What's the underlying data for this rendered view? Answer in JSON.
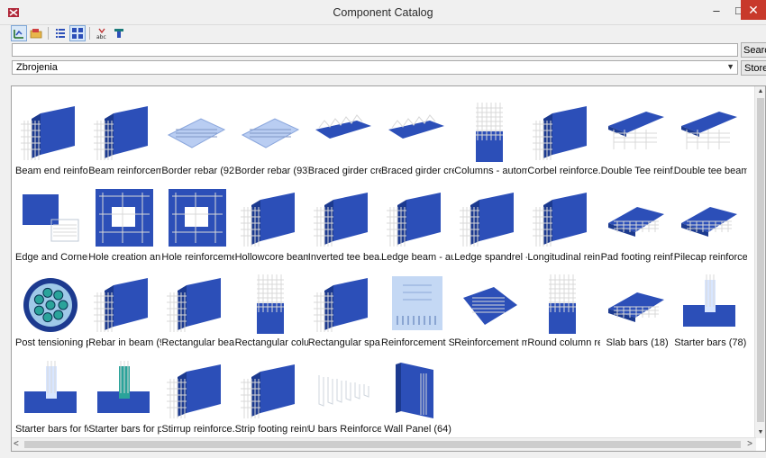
{
  "window": {
    "title": "Component Catalog"
  },
  "window_controls": {
    "minimize": "–",
    "maximize": "□",
    "close": "✕"
  },
  "toolbar": {
    "buttons": [
      "group-view-icon",
      "folder-icon",
      "list-view-icon",
      "thumbnail-view-icon",
      "abc-sort-icon",
      "filter-icon"
    ]
  },
  "search": {
    "value": "",
    "button_label": "Search"
  },
  "catalog_selector": {
    "value": "Zbrojenia",
    "store_label": "Store"
  },
  "colors": {
    "blue": "#2c4fb8",
    "dark_blue": "#1c3a8f",
    "teal": "#2aa39a",
    "rebar": "#d8d8d8",
    "close_red": "#c8392b"
  },
  "items": [
    {
      "label": "Beam end reinfor...",
      "icon": "beam-end-reinforcement-icon"
    },
    {
      "label": "Beam reinforcem...",
      "icon": "beam-reinforcement-icon"
    },
    {
      "label": "Border rebar (92)",
      "icon": "border-rebar-icon"
    },
    {
      "label": "Border rebar (93)",
      "icon": "border-rebar-icon"
    },
    {
      "label": "Braced girder cre...",
      "icon": "braced-girder-icon"
    },
    {
      "label": "Braced girder cre...",
      "icon": "braced-girder-icon"
    },
    {
      "label": "Columns - autom...",
      "icon": "columns-icon"
    },
    {
      "label": "Corbel reinforce...",
      "icon": "corbel-reinforcement-icon"
    },
    {
      "label": "Double Tee reinf...",
      "icon": "double-tee-icon"
    },
    {
      "label": "Double tee beam...",
      "icon": "double-tee-beam-icon"
    },
    {
      "label": "Edge and Corner...",
      "icon": "edge-corner-icon"
    },
    {
      "label": "Hole creation an...",
      "icon": "hole-creation-icon"
    },
    {
      "label": "Hole reinforceme...",
      "icon": "hole-reinforcement-icon"
    },
    {
      "label": "Hollowcore beam...",
      "icon": "hollowcore-beam-icon"
    },
    {
      "label": "Inverted tee bea...",
      "icon": "inverted-tee-beam-icon"
    },
    {
      "label": "Ledge beam - au...",
      "icon": "ledge-beam-icon"
    },
    {
      "label": "Ledge spandrel - ...",
      "icon": "ledge-spandrel-icon"
    },
    {
      "label": "Longitudinal reinf...",
      "icon": "longitudinal-reinforcement-icon"
    },
    {
      "label": "Pad footing reinf...",
      "icon": "pad-footing-icon"
    },
    {
      "label": "Pilecap reinforce...",
      "icon": "pilecap-reinforcement-icon"
    },
    {
      "label": "Post tensioning p...",
      "icon": "post-tensioning-icon"
    },
    {
      "label": "Rebar in beam (90)",
      "icon": "rebar-in-beam-icon"
    },
    {
      "label": "Rectangular bea...",
      "icon": "rectangular-beam-icon"
    },
    {
      "label": "Rectangular colu...",
      "icon": "rectangular-column-icon"
    },
    {
      "label": "Rectangular spa...",
      "icon": "rectangular-spandrel-icon"
    },
    {
      "label": "Reinforcement St...",
      "icon": "reinforcement-strip-icon"
    },
    {
      "label": "Reinforcement m...",
      "icon": "reinforcement-mesh-icon"
    },
    {
      "label": "Round column re...",
      "icon": "round-column-icon"
    },
    {
      "label": "Slab bars (18)",
      "icon": "slab-bars-icon"
    },
    {
      "label": "Starter bars (78)",
      "icon": "starter-bars-icon"
    },
    {
      "label": "Starter bars for fo...",
      "icon": "starter-bars-footing-icon"
    },
    {
      "label": "Starter bars for pi...",
      "icon": "starter-bars-pile-icon"
    },
    {
      "label": "Stirrup reinforce...",
      "icon": "stirrup-reinforcement-icon"
    },
    {
      "label": "Strip footing reinf...",
      "icon": "strip-footing-icon"
    },
    {
      "label": "U bars Reinforce...",
      "icon": "u-bars-icon"
    },
    {
      "label": "Wall Panel (64)",
      "icon": "wall-panel-icon"
    }
  ]
}
